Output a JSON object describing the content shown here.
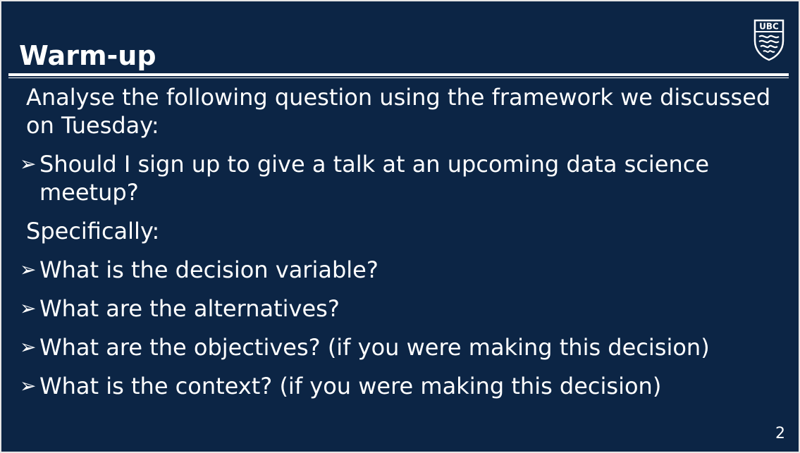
{
  "slide": {
    "title": "Warm-up",
    "logo_text": "UBC",
    "page_number": "2",
    "items": [
      {
        "type": "plain",
        "text": "Analyse the following question using the framework we discussed on Tuesday:"
      },
      {
        "type": "bullet",
        "marker": "➢",
        "text": "Should I sign up to give a talk at an upcoming data science meetup?"
      },
      {
        "type": "plain",
        "text": "Specifically:"
      },
      {
        "type": "bullet",
        "marker": "➢",
        "text": "What is the decision variable?"
      },
      {
        "type": "bullet",
        "marker": "➢",
        "text": "What are the alternatives?"
      },
      {
        "type": "bullet",
        "marker": "➢",
        "text": "What are the objectives? (if you were making this decision)"
      },
      {
        "type": "bullet",
        "marker": "➢",
        "text": "What is the context? (if you were making this decision)"
      }
    ]
  },
  "colors": {
    "background": "#0c2545",
    "text": "#ffffff",
    "frame": "#e6e6e6"
  },
  "icons": {
    "logo": "ubc-crest-icon",
    "bullet": "arrowhead-bullet-icon"
  }
}
